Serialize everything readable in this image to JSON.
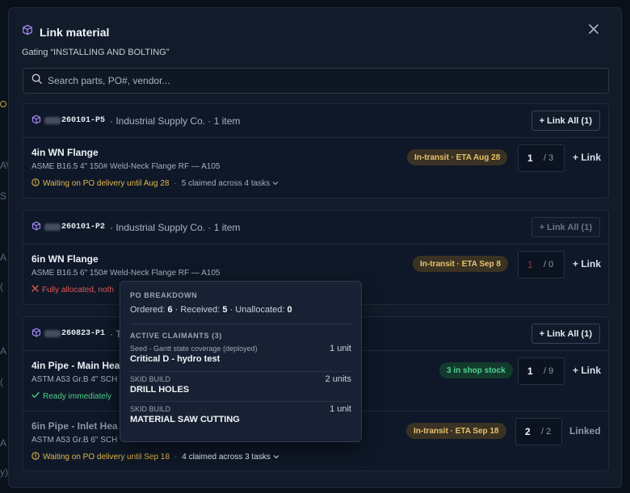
{
  "modal": {
    "title": "Link material",
    "subtitle": "Gating “INSTALLING AND BOLTING”",
    "search_placeholder": "Search parts, PO#, vendor..."
  },
  "groups": [
    {
      "po_suffix": "260101-P5",
      "vendor": "· Industrial Supply Co. · 1 item",
      "link_all_label": "+ Link All (1)",
      "link_all_enabled": true,
      "items": [
        {
          "name": "4in WN Flange",
          "spec": "ASME B16.5 4\" 150# Weld-Neck Flange RF — A105",
          "status": "Waiting on PO delivery until Aug 28",
          "claimed": "5 claimed across 4 tasks",
          "badge": "In-transit · ETA Aug 28",
          "qty": "1",
          "qty_max": "/ 3",
          "action": "+ Link"
        }
      ]
    },
    {
      "po_suffix": "260101-P2",
      "vendor": "· Industrial Supply Co. · 1 item",
      "link_all_label": "+ Link All (1)",
      "link_all_enabled": false,
      "items": [
        {
          "name": "6in WN Flange",
          "spec": "ASME B16.5 6\" 150# Weld-Neck Flange RF — A105",
          "status": "Fully allocated, noth",
          "badge": "In-transit · ETA Sep 8",
          "qty": "1",
          "qty_max": "/ 0",
          "action": "+ Link"
        }
      ]
    },
    {
      "po_suffix": "260823-P1",
      "vendor": "· T",
      "link_all_label": "+ Link All (1)",
      "link_all_enabled": true,
      "items": [
        {
          "name": "4in Pipe - Main Hea",
          "spec": "ASTM A53 Gr.B 4\" SCH",
          "status": "Ready immediately",
          "badge": "3 in shop stock",
          "qty": "1",
          "qty_max": "/ 9",
          "action": "+ Link"
        },
        {
          "name": "6in Pipe - Inlet Hea",
          "spec": "ASTM A53 Gr.B 6\" SCH",
          "status": "Waiting on PO delivery until Sep 18",
          "claimed": "4 claimed across 3 tasks",
          "badge": "In-transit · ETA Sep 18",
          "qty": "2",
          "qty_max": "/ 2",
          "action": "Linked"
        }
      ]
    }
  ],
  "popover": {
    "breakdown_label": "PO BREAKDOWN",
    "ordered_label": "Ordered:",
    "ordered": "6",
    "received_label": "· Received:",
    "received": "5",
    "unallocated_label": "· Unallocated:",
    "unallocated": "0",
    "claimants_label": "ACTIVE CLAIMANTS (3)",
    "claimants": [
      {
        "project": "Seed - Gantt state coverage (deployed)",
        "task": "Critical D - hydro test",
        "units": "1 unit"
      },
      {
        "project": "SKID BUILD",
        "task": "DRILL HOLES",
        "units": "2 units"
      },
      {
        "project": "SKID BUILD",
        "task": "MATERIAL SAW CUTTING",
        "units": "1 unit"
      }
    ]
  },
  "background": [
    "AV",
    "S",
    "A",
    "(",
    "A",
    "(",
    "A",
    "y)"
  ],
  "colors": {
    "accent_purple": "#a78bfa",
    "warning": "#e1b84a",
    "error": "#e05757",
    "success": "#4fcf8b"
  },
  "icons": {
    "title": "cube-icon",
    "close": "close-icon",
    "search": "search-icon",
    "po": "cube-icon",
    "waiting": "info-circle-icon",
    "error": "x-icon",
    "ready": "check-icon",
    "expand": "chevron-down-icon"
  }
}
